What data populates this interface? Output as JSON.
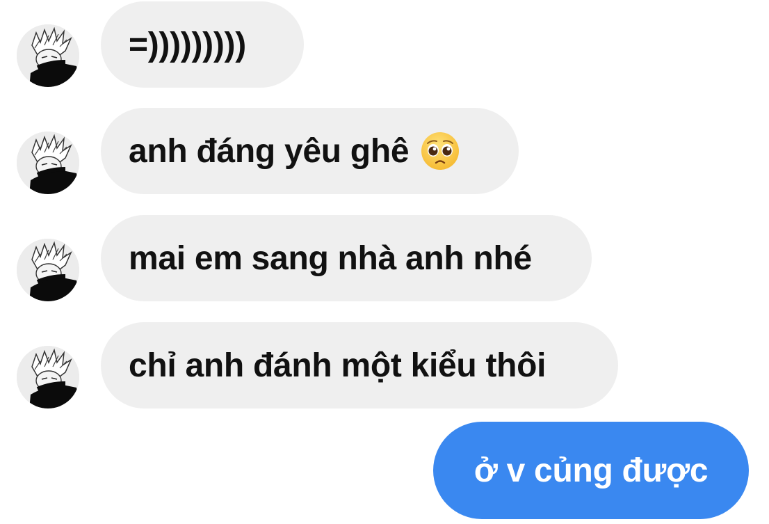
{
  "conversation": {
    "incoming_messages": [
      {
        "text": "=)))))))))"
      },
      {
        "text": "anh đáng yêu ghê",
        "emoji": "pleading-face-emoji"
      },
      {
        "text": "mai em sang nhà anh nhé"
      },
      {
        "text": "chỉ anh đánh một kiểu thôi"
      }
    ],
    "outgoing_messages": [
      {
        "text": "ở v củng được"
      }
    ]
  },
  "colors": {
    "incoming_bubble": "#efefef",
    "incoming_text": "#111111",
    "outgoing_bubble": "#3a88f0",
    "outgoing_text": "#ffffff"
  },
  "icons": {
    "avatar": "contact-avatar-manga-character",
    "emoji": "pleading-face-emoji"
  }
}
